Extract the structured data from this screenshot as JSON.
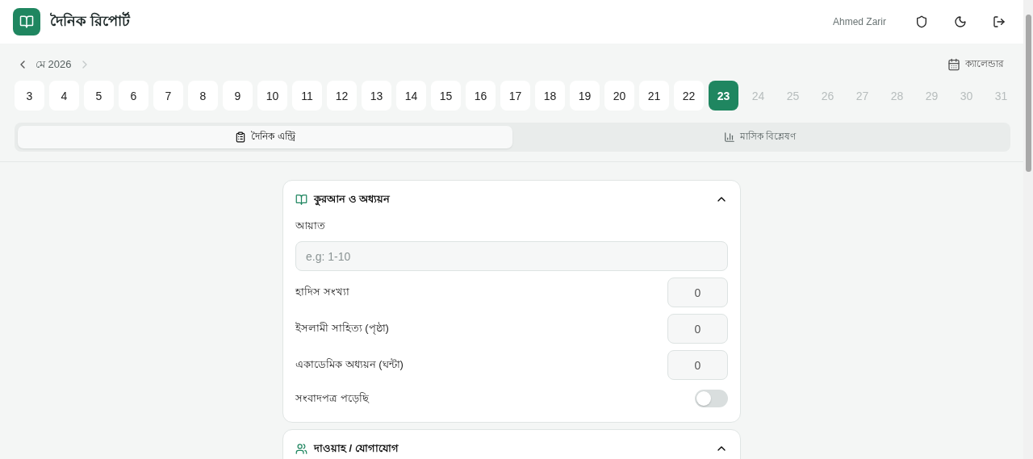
{
  "header": {
    "title": "দৈনিক রিপোর্ট",
    "user": "Ahmed Zarir"
  },
  "month_nav": {
    "label": "মে 2026",
    "calendar_label": "ক্যালেন্ডার"
  },
  "days": [
    {
      "label": "3",
      "selected": false,
      "disabled": false
    },
    {
      "label": "4",
      "selected": false,
      "disabled": false
    },
    {
      "label": "5",
      "selected": false,
      "disabled": false
    },
    {
      "label": "6",
      "selected": false,
      "disabled": false
    },
    {
      "label": "7",
      "selected": false,
      "disabled": false
    },
    {
      "label": "8",
      "selected": false,
      "disabled": false
    },
    {
      "label": "9",
      "selected": false,
      "disabled": false
    },
    {
      "label": "10",
      "selected": false,
      "disabled": false
    },
    {
      "label": "11",
      "selected": false,
      "disabled": false
    },
    {
      "label": "12",
      "selected": false,
      "disabled": false
    },
    {
      "label": "13",
      "selected": false,
      "disabled": false
    },
    {
      "label": "14",
      "selected": false,
      "disabled": false
    },
    {
      "label": "15",
      "selected": false,
      "disabled": false
    },
    {
      "label": "16",
      "selected": false,
      "disabled": false
    },
    {
      "label": "17",
      "selected": false,
      "disabled": false
    },
    {
      "label": "18",
      "selected": false,
      "disabled": false
    },
    {
      "label": "19",
      "selected": false,
      "disabled": false
    },
    {
      "label": "20",
      "selected": false,
      "disabled": false
    },
    {
      "label": "21",
      "selected": false,
      "disabled": false
    },
    {
      "label": "22",
      "selected": false,
      "disabled": false
    },
    {
      "label": "23",
      "selected": true,
      "disabled": false
    },
    {
      "label": "24",
      "selected": false,
      "disabled": true
    },
    {
      "label": "25",
      "selected": false,
      "disabled": true
    },
    {
      "label": "26",
      "selected": false,
      "disabled": true
    },
    {
      "label": "27",
      "selected": false,
      "disabled": true
    },
    {
      "label": "28",
      "selected": false,
      "disabled": true
    },
    {
      "label": "29",
      "selected": false,
      "disabled": true
    },
    {
      "label": "30",
      "selected": false,
      "disabled": true
    },
    {
      "label": "31",
      "selected": false,
      "disabled": true
    }
  ],
  "tabs": [
    {
      "label": "দৈনিক এন্ট্রি",
      "kind": "entry",
      "selected": true
    },
    {
      "label": "মাসিক বিশ্লেষণ",
      "kind": "chart",
      "selected": false
    }
  ],
  "sections": [
    {
      "title": "কুরআন ও অধ্যয়ন",
      "kind": "book",
      "expanded": true,
      "fields": [
        {
          "kind": "text",
          "label": "আয়াত",
          "placeholder": "e.g: 1-10"
        },
        {
          "kind": "number",
          "label": "হাদিস সংখ্যা",
          "value": "0"
        },
        {
          "kind": "number",
          "label": "ইসলামী সাহিত্য (পৃষ্ঠা)",
          "value": "0"
        },
        {
          "kind": "number",
          "label": "একাডেমিক অধ্যয়ন (ঘন্টা)",
          "value": "0"
        },
        {
          "kind": "toggle",
          "label": "সংবাদপত্র পড়েছি",
          "on": false
        }
      ]
    },
    {
      "title": "দাওয়াহ / যোগাযোগ",
      "kind": "people",
      "expanded": true
    }
  ]
}
